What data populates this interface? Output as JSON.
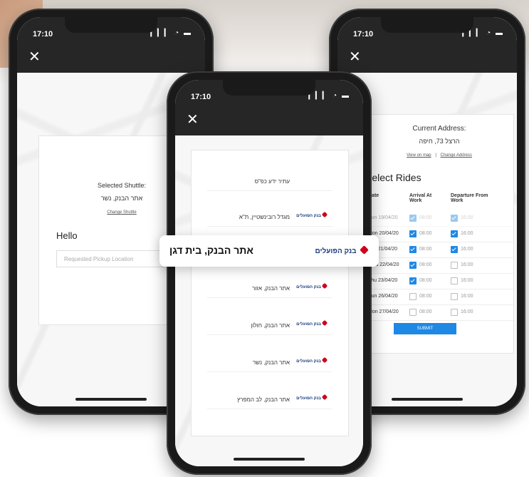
{
  "phones": {
    "left": {
      "time": "17:10",
      "status_icons": "▎▎▎ ◔ ▬",
      "close_symbol": "✕",
      "selected_label": "Selected Shuttle:",
      "selected_name": "אתר הבנק, נשר",
      "change_link": "Change Shuttle",
      "greeting": "Hello",
      "pickup_placeholder": "Requested Pickup Location"
    },
    "center": {
      "time": "17:10",
      "status_icons": "▎▎▎ ◔ ▬",
      "close_symbol": "✕",
      "logo_text": "בנק הפועלים",
      "items": [
        {
          "label": "עתיר ידע כפ\"ס",
          "logo": false
        },
        {
          "label": "מגדל רובינשטיין, ת\"א",
          "logo": true
        },
        {
          "label": "אתר הבנק, אזור",
          "logo": true
        },
        {
          "label": "אתר הבנק, חולון",
          "logo": true
        },
        {
          "label": "אתר הבנק, נשר",
          "logo": true
        },
        {
          "label": "אתר הבנק, לב המפרץ",
          "logo": true
        }
      ],
      "highlight": {
        "label": "אתר הבנק, בית דגן",
        "logo_text": "בנק הפועלים"
      }
    },
    "right": {
      "time": "17:10",
      "status_icons": "▎▎▎ ◔ ▬",
      "close_symbol": "✕",
      "current_address_label": "Current Address:",
      "current_address": "הרצל 73, חיפה",
      "view_on_map": "View on map",
      "separator": "|",
      "change_address": "Change Address",
      "section_title": "Select Rides",
      "col_date": "Date",
      "col_arrival": "Arrival At Work",
      "col_departure": "Departure From Work",
      "rows": [
        {
          "date": "Sun 19/04/20",
          "arr_time": "08:00",
          "arr": true,
          "dep_time": "16:00",
          "dep": true,
          "dim": true
        },
        {
          "date": "Mon 20/04/20",
          "arr_time": "08:00",
          "arr": true,
          "dep_time": "16:00",
          "dep": true,
          "dim": false
        },
        {
          "date": "Tue 21/04/20",
          "arr_time": "08:00",
          "arr": true,
          "dep_time": "16:00",
          "dep": true,
          "dim": false
        },
        {
          "date": "Wed 22/04/20",
          "arr_time": "08:00",
          "arr": true,
          "dep_time": "16:00",
          "dep": false,
          "dim": false
        },
        {
          "date": "Thu 23/04/20",
          "arr_time": "08:00",
          "arr": true,
          "dep_time": "16:00",
          "dep": false,
          "dim": false
        },
        {
          "date": "Sun 26/04/20",
          "arr_time": "08:00",
          "arr": false,
          "dep_time": "16:00",
          "dep": false,
          "dim": false
        },
        {
          "date": "Mon 27/04/20",
          "arr_time": "08:00",
          "arr": false,
          "dep_time": "16:00",
          "dep": false,
          "dim": false
        }
      ],
      "submit_label": "SUBMIT"
    }
  },
  "colors": {
    "accent": "#1e88e5",
    "logo_red": "#d0021b",
    "logo_blue": "#1a3d7c",
    "status_bar": "#262626"
  }
}
